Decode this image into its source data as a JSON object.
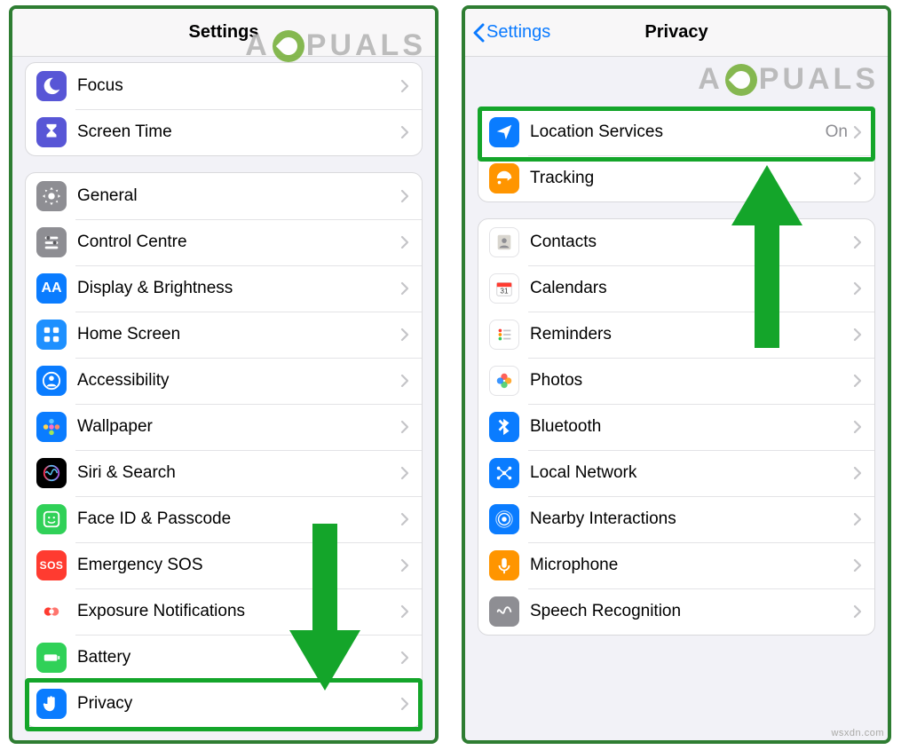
{
  "watermark": "A PUALS",
  "credit": "wsxdn.com",
  "left": {
    "title": "Settings",
    "group1": [
      {
        "name": "focus",
        "label": "Focus",
        "iconClass": "sq-indigo",
        "glyph": "moon"
      },
      {
        "name": "screen-time",
        "label": "Screen Time",
        "iconClass": "sq-violet",
        "glyph": "hourglass"
      }
    ],
    "group2": [
      {
        "name": "general",
        "label": "General",
        "iconClass": "sq-gray",
        "glyph": "gear"
      },
      {
        "name": "control-centre",
        "label": "Control Centre",
        "iconClass": "sq-gray",
        "glyph": "sliders"
      },
      {
        "name": "display-brightness",
        "label": "Display & Brightness",
        "iconClass": "sq-blue",
        "glyph": "aa"
      },
      {
        "name": "home-screen",
        "label": "Home Screen",
        "iconClass": "sq-bluebright",
        "glyph": "grid"
      },
      {
        "name": "accessibility",
        "label": "Accessibility",
        "iconClass": "sq-accblue",
        "glyph": "person"
      },
      {
        "name": "wallpaper",
        "label": "Wallpaper",
        "iconClass": "sq-blue",
        "glyph": "flower"
      },
      {
        "name": "siri-search",
        "label": "Siri & Search",
        "iconClass": "sq-black",
        "glyph": "siri"
      },
      {
        "name": "faceid-passcode",
        "label": "Face ID & Passcode",
        "iconClass": "sq-green",
        "glyph": "face"
      },
      {
        "name": "emergency-sos",
        "label": "Emergency SOS",
        "iconClass": "sq-red",
        "glyph": "sos"
      },
      {
        "name": "exposure-notif",
        "label": "Exposure Notifications",
        "iconClass": "sq-white",
        "glyph": "exposure"
      },
      {
        "name": "battery",
        "label": "Battery",
        "iconClass": "sq-greenbtn",
        "glyph": "battery"
      },
      {
        "name": "privacy",
        "label": "Privacy",
        "iconClass": "sq-blue",
        "glyph": "hand"
      }
    ]
  },
  "right": {
    "title": "Privacy",
    "back": "Settings",
    "group1": [
      {
        "name": "location-services",
        "label": "Location Services",
        "value": "On",
        "iconClass": "sq-blue",
        "glyph": "arrow"
      },
      {
        "name": "tracking",
        "label": "Tracking",
        "iconClass": "sq-orange",
        "glyph": "track"
      }
    ],
    "group2": [
      {
        "name": "contacts",
        "label": "Contacts",
        "iconClass": "sq-whiteb",
        "glyph": "contacts"
      },
      {
        "name": "calendars",
        "label": "Calendars",
        "iconClass": "sq-whiteb",
        "glyph": "calendar"
      },
      {
        "name": "reminders",
        "label": "Reminders",
        "iconClass": "sq-whiteb",
        "glyph": "reminders"
      },
      {
        "name": "photos",
        "label": "Photos",
        "iconClass": "sq-whiteb",
        "glyph": "photos"
      },
      {
        "name": "bluetooth",
        "label": "Bluetooth",
        "iconClass": "sq-blue",
        "glyph": "bt"
      },
      {
        "name": "local-network",
        "label": "Local Network",
        "iconClass": "sq-blue",
        "glyph": "net"
      },
      {
        "name": "nearby-interactions",
        "label": "Nearby Interactions",
        "iconClass": "sq-blue",
        "glyph": "nearby"
      },
      {
        "name": "microphone",
        "label": "Microphone",
        "iconClass": "sq-orange",
        "glyph": "mic"
      },
      {
        "name": "speech-recognition",
        "label": "Speech Recognition",
        "iconClass": "sq-gray",
        "glyph": "speech"
      }
    ]
  }
}
